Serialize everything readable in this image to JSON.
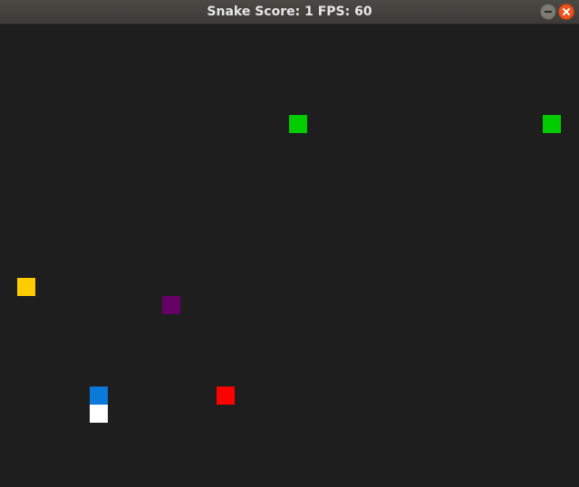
{
  "window": {
    "title": "Snake Score: 1 FPS: 60",
    "minimize_icon": "minimize-icon",
    "close_icon": "close-icon"
  },
  "game": {
    "score": 1,
    "fps": 60,
    "background": "#1e1e1e"
  },
  "colors": {
    "food_green": "#00cc00",
    "food_yellow": "#ffcc00",
    "food_purple": "#660066",
    "food_red": "#ff0000",
    "snake_head": "#0a7ad8",
    "snake_body": "#ffffff",
    "close_button": "#e9541f"
  }
}
